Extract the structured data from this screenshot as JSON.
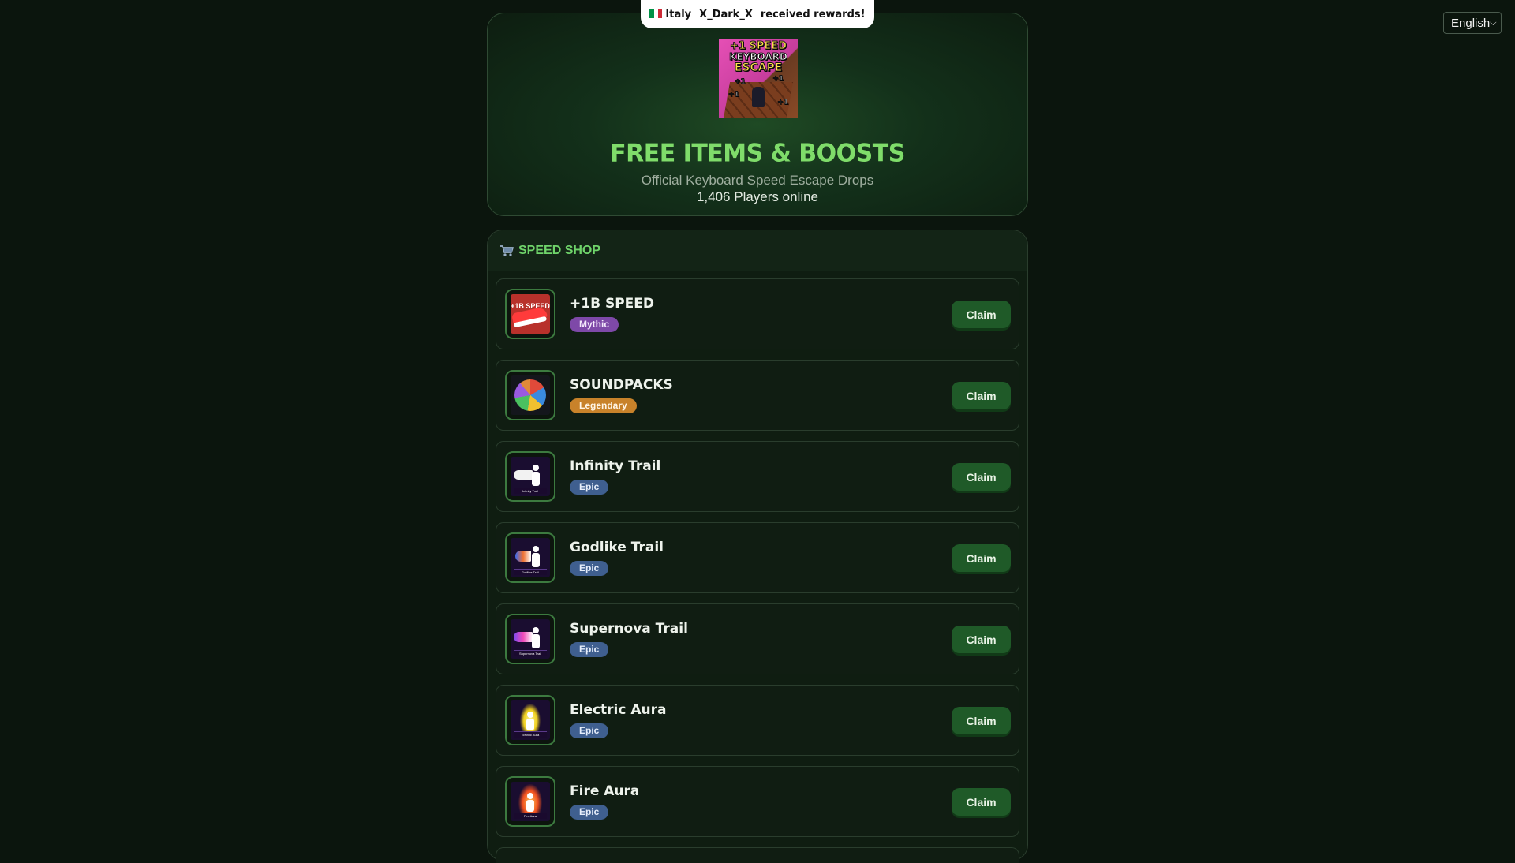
{
  "toast": {
    "country": "Italy",
    "player": "X_Dark_X",
    "message": "received rewards!",
    "flag_colors": [
      "#009246",
      "#ffffff",
      "#ce2b37"
    ]
  },
  "language": {
    "selected": "English"
  },
  "hero": {
    "logo_text": {
      "line1": "+1 SPEED",
      "line2": "KEYBOARD",
      "line3": "ESCAPE",
      "tag": "+1"
    },
    "title": "FREE ITEMS & BOOSTS",
    "subtitle": "Official Keyboard Speed Escape Drops",
    "online": "1,406 Players online"
  },
  "shop": {
    "title": "SPEED SHOP",
    "icon": "cart-icon",
    "items": [
      {
        "name": "+1B SPEED",
        "rarity": "Mythic",
        "button": "Claim",
        "thumb_label": "+1B SPEED",
        "icon": "speed-shoe-icon"
      },
      {
        "name": "SOUNDPACKS",
        "rarity": "Legendary",
        "button": "Claim",
        "icon": "soundpack-orb-icon"
      },
      {
        "name": "Infinity Trail",
        "rarity": "Epic",
        "button": "Claim",
        "thumb_label": "Infinity Trail",
        "icon": "trail-runner-icon"
      },
      {
        "name": "Godlike Trail",
        "rarity": "Epic",
        "button": "Claim",
        "thumb_label": "Godlike Trail",
        "icon": "trail-runner-icon"
      },
      {
        "name": "Supernova Trail",
        "rarity": "Epic",
        "button": "Claim",
        "thumb_label": "Supernova Trail",
        "icon": "trail-runner-icon"
      },
      {
        "name": "Electric Aura",
        "rarity": "Epic",
        "button": "Claim",
        "thumb_label": "Electric Aura",
        "icon": "aura-icon"
      },
      {
        "name": "Fire Aura",
        "rarity": "Epic",
        "button": "Claim",
        "thumb_label": "Fire Aura",
        "icon": "aura-icon"
      }
    ]
  },
  "colors": {
    "background": "#0b150d",
    "accent_green": "#7fdc6a",
    "claim_button": "#1f5a28",
    "mythic": "#7e49a8",
    "legendary": "#c8822a",
    "epic": "#3f5f8f"
  }
}
